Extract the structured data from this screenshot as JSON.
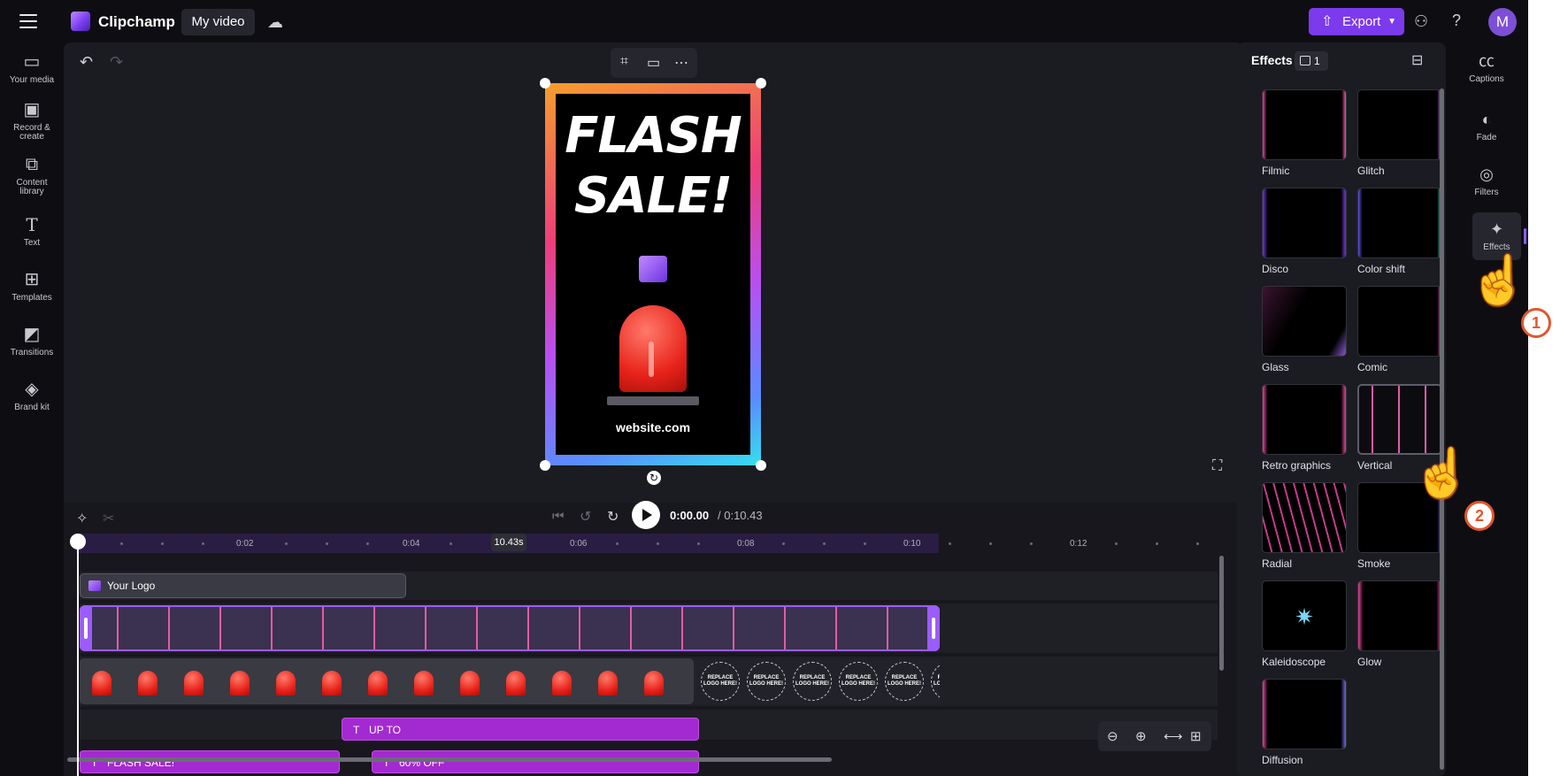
{
  "app": {
    "brand": "Clipchamp",
    "video_name": "My video",
    "export_label": "Export",
    "avatar_initial": "M",
    "accent_color": "#7c3aed"
  },
  "left_rail": [
    {
      "label": "Your media",
      "icon": "folder-icon"
    },
    {
      "label": "Record & create",
      "icon": "camera-icon"
    },
    {
      "label": "Content library",
      "icon": "library-icon"
    },
    {
      "label": "Text",
      "icon": "text-icon"
    },
    {
      "label": "Templates",
      "icon": "templates-icon"
    },
    {
      "label": "Transitions",
      "icon": "transitions-icon"
    },
    {
      "label": "Brand kit",
      "icon": "brand-kit-icon"
    }
  ],
  "preview": {
    "headline_line1": "FLASH",
    "headline_line2": "SALE!",
    "website": "website.com"
  },
  "playback": {
    "current_time": "0:00.00",
    "total_time": "/ 0:10.43"
  },
  "timeline": {
    "ticks": [
      "0:02",
      "0:04",
      "0:06",
      "0:08",
      "0:10",
      "0:12"
    ],
    "cursor_label": "10.43s",
    "logo_clip": "Your Logo",
    "replace_text": "REPLACE LOGO HERE!",
    "text_clips": [
      "UP TO",
      "FLASH SALE!",
      "60% OFF"
    ]
  },
  "effects_panel": {
    "title": "Effects",
    "count": "1",
    "effects": [
      {
        "label": "Filmic"
      },
      {
        "label": "Glitch"
      },
      {
        "label": "Disco"
      },
      {
        "label": "Color shift"
      },
      {
        "label": "Glass"
      },
      {
        "label": "Comic"
      },
      {
        "label": "Retro graphics"
      },
      {
        "label": "Vertical",
        "selected": true
      },
      {
        "label": "Radial"
      },
      {
        "label": "Smoke"
      },
      {
        "label": "Kaleidoscope"
      },
      {
        "label": "Glow"
      },
      {
        "label": "Diffusion"
      }
    ]
  },
  "right_rail": [
    {
      "label": "Captions",
      "icon": "captions-icon"
    },
    {
      "label": "Fade",
      "icon": "fade-icon"
    },
    {
      "label": "Filters",
      "icon": "filters-icon"
    },
    {
      "label": "Effects",
      "icon": "effects-wand-icon",
      "active": true
    }
  ],
  "annotations": {
    "step1": "1",
    "step2": "2"
  }
}
